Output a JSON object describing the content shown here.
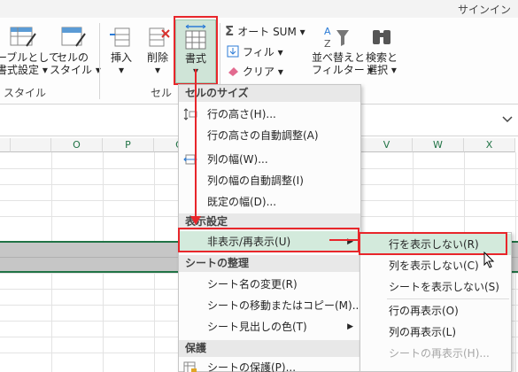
{
  "titlebar": {
    "signin": "サインイン"
  },
  "ribbon": {
    "format_as_table": "ーブルとして\n書式設定 ▾",
    "cell_styles": "セルの\nスタイル ▾",
    "styles_group": "スタイル",
    "insert": "挿入\n▾",
    "delete": "削除\n▾",
    "format": "書式\n▾",
    "cells_group": "セル",
    "autosum": "オート SUM ▾",
    "fill": "フィル ▾",
    "clear": "クリア ▾",
    "sort_filter": "並べ替えと\nフィルター ▾",
    "find_select": "検索と\n選択 ▾",
    "autosum_sigma": "Σ",
    "sort_az": "A↓Z"
  },
  "columns": [
    "O",
    "P",
    "Q",
    "V",
    "W",
    "X"
  ],
  "format_menu": {
    "sections": {
      "cell_size": "セルのサイズ",
      "visibility": "表示設定",
      "organize_sheets": "シートの整理",
      "protection": "保護"
    },
    "items": {
      "row_height": "行の高さ(H)...",
      "autofit_row": "行の高さの自動調整(A)",
      "col_width": "列の幅(W)...",
      "autofit_col": "列の幅の自動調整(I)",
      "default_width": "既定の幅(D)...",
      "hide_unhide": "非表示/再表示(U)",
      "rename_sheet": "シート名の変更(R)",
      "move_copy": "シートの移動またはコピー(M)...",
      "tab_color": "シート見出しの色(T)",
      "protect_sheet": "シートの保護(P)..."
    }
  },
  "hide_submenu": {
    "hide_rows": "行を表示しない(R)",
    "hide_columns": "列を表示しない(C)",
    "hide_sheet": "シートを表示しない(S)",
    "unhide_rows": "行の再表示(O)",
    "unhide_columns": "列の再表示(L)",
    "unhide_sheet": "シートの再表示(H)..."
  },
  "colors": {
    "accent": "#217346",
    "highlight": "#d3eadc",
    "callout": "#e8262b"
  }
}
